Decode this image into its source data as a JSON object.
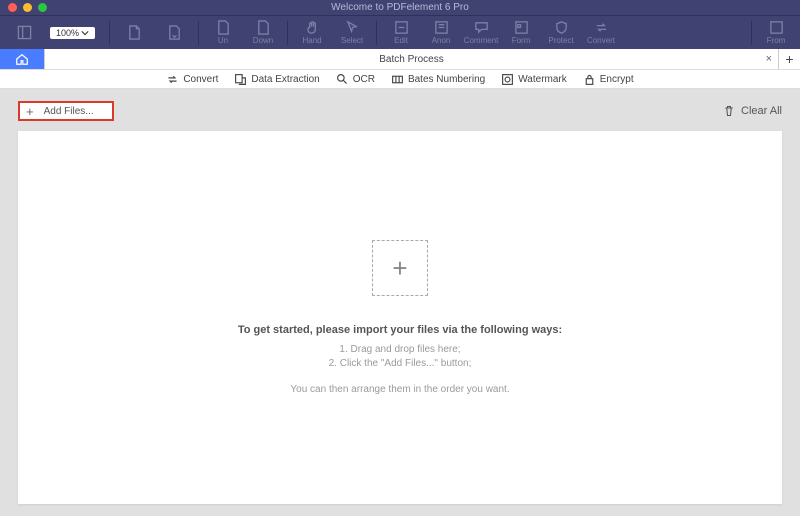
{
  "titlebar": {
    "title": "Welcome to PDFelement 6 Pro"
  },
  "toolbar": {
    "zoom": "100%",
    "items": [
      "",
      "",
      "Un",
      "Down",
      "Hand",
      "Select",
      "Edit",
      "Anon",
      "Comment",
      "Form",
      "Protect",
      "Convert"
    ],
    "right": "From"
  },
  "tabs": {
    "batch": "Batch Process"
  },
  "subtabs": {
    "convert": "Convert",
    "extract": "Data Extraction",
    "ocr": "OCR",
    "bates": "Bates Numbering",
    "watermark": "Watermark",
    "encrypt": "Encrypt"
  },
  "actions": {
    "add_files": "Add Files...",
    "clear_all": "Clear All"
  },
  "empty": {
    "heading": "To get started, please import your files via the following ways:",
    "line1": "1. Drag and drop files here;",
    "line2": "2. Click the \"Add Files...\" button;",
    "footer": "You can then arrange them in the order you want."
  }
}
